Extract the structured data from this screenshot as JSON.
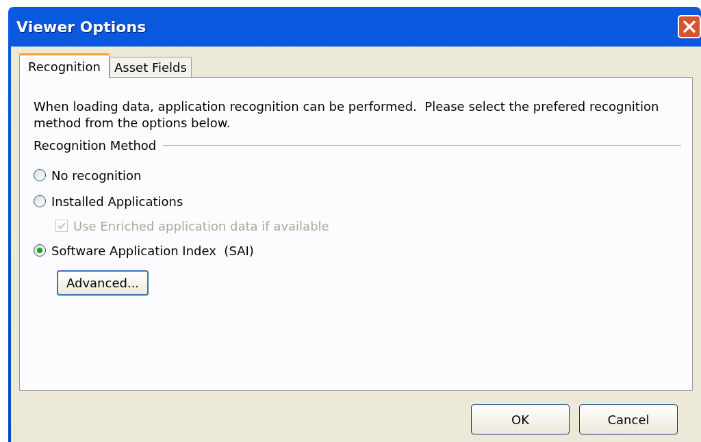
{
  "window": {
    "title": "Viewer Options"
  },
  "tabs": [
    {
      "label": "Recognition",
      "selected": true
    },
    {
      "label": "Asset Fields",
      "selected": false
    }
  ],
  "description": "When loading data, application recognition can be performed.  Please select the prefered recognition method from the options below.",
  "group": {
    "title": "Recognition Method",
    "options": [
      {
        "kind": "radio",
        "label": "No recognition",
        "selected": false
      },
      {
        "kind": "radio",
        "label": "Installed Applications",
        "selected": false,
        "children": [
          {
            "kind": "checkbox",
            "label": "Use Enriched application data if available",
            "checked": true,
            "disabled": true
          }
        ]
      },
      {
        "kind": "radio",
        "label": "Software Application Index  (SAI)",
        "selected": true
      }
    ],
    "button": "Advanced..."
  },
  "buttons": [
    "OK",
    "Cancel"
  ]
}
